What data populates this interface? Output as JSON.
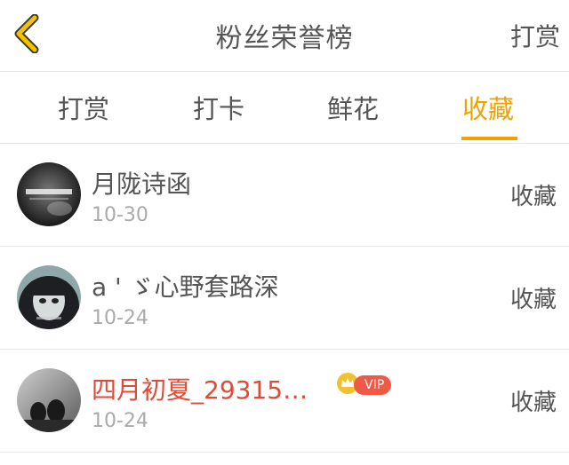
{
  "header": {
    "title": "粉丝荣誉榜",
    "action_label": "打赏"
  },
  "tabs": [
    {
      "label": "打赏"
    },
    {
      "label": "打卡"
    },
    {
      "label": "鲜花"
    },
    {
      "label": "收藏"
    }
  ],
  "active_tab": "收藏",
  "colors": {
    "accent": "#f0a300",
    "highlight_name": "#e04a36",
    "vip_badge": "#ef5a47"
  },
  "items": [
    {
      "name": "月陇诗函",
      "date": "10-30",
      "action": "收藏"
    },
    {
      "name": "a ' ゞ心野套路深",
      "date": "10-24",
      "action": "收藏"
    },
    {
      "name": "四月初夏_29315…",
      "date": "10-24",
      "action": "收藏",
      "vip_label": "VIP"
    }
  ]
}
